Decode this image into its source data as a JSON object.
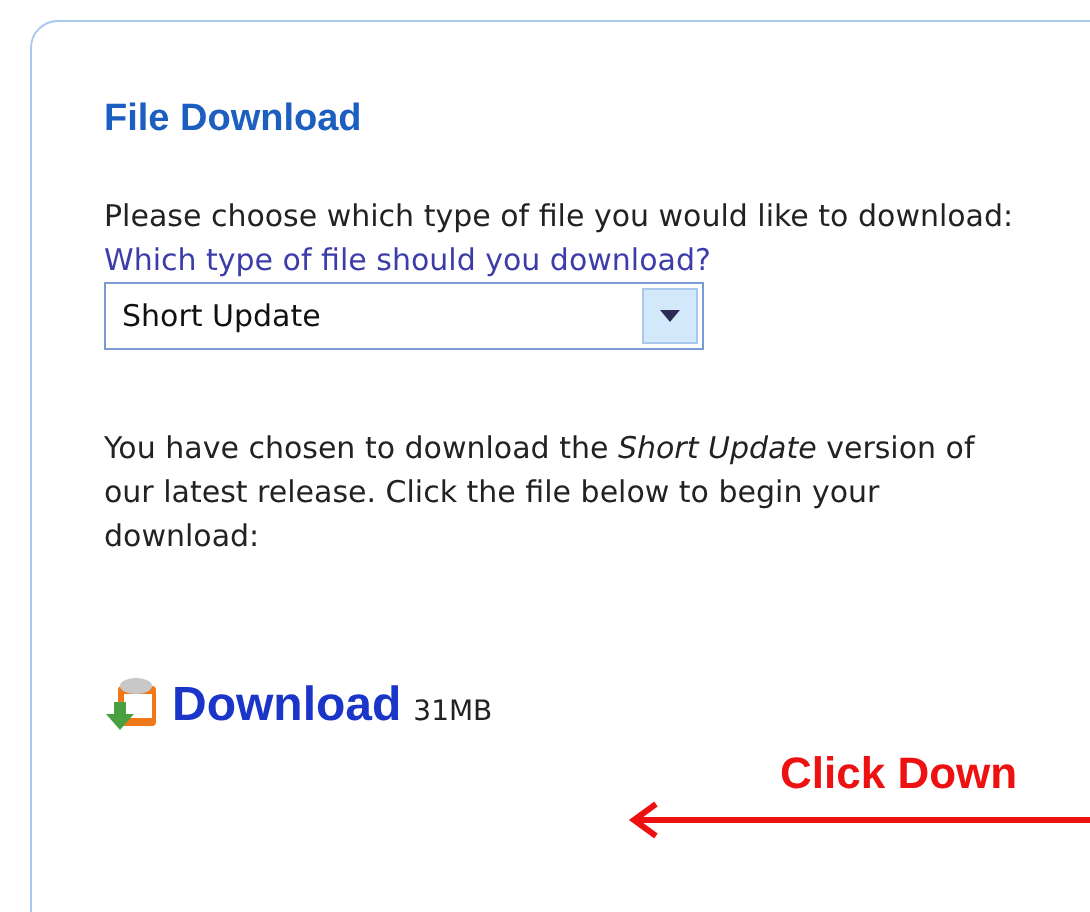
{
  "panel": {
    "title": "File Download",
    "prompt": "Please choose which type of file you would like to download:",
    "select_label": "Which type of file should you download?",
    "select_value": "Short Update",
    "description": "You have chosen to download the *Short Update* version of our latest release. Click the file below to begin your download:",
    "download_link": "Download",
    "download_size": "31MB"
  },
  "annotation": {
    "text": "Click Down"
  }
}
